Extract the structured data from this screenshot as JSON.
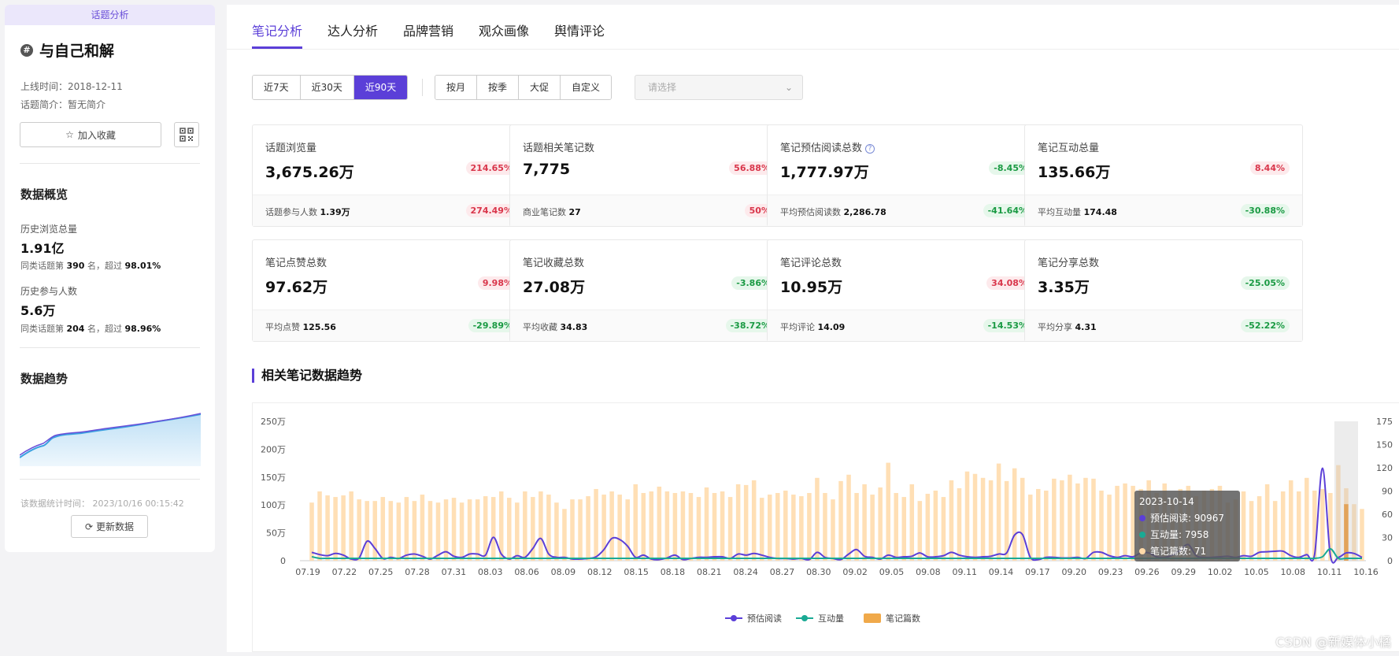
{
  "left": {
    "tag": "话题分析",
    "topic_title": "与自己和解",
    "online_time": "上线时间：2018-12-11",
    "intro": "话题简介：暂无简介",
    "fav_label": "加入收藏",
    "overview_title": "数据概览",
    "hist_views_label": "历史浏览总量",
    "hist_views_value": "1.91亿",
    "hist_views_rank_a": "同类话题第 ",
    "hist_views_rank_b": "390",
    "hist_views_rank_c": " 名，超过 ",
    "hist_views_rank_d": "98.01%",
    "hist_users_label": "历史参与人数",
    "hist_users_value": "5.6万",
    "hist_users_rank_a": "同类话题第 ",
    "hist_users_rank_b": "204",
    "hist_users_rank_c": " 名，超过 ",
    "hist_users_rank_d": "98.96%",
    "trend_title": "数据趋势",
    "stat_time": "该数据统计时间：  2023/10/16 00:15:42",
    "refresh_label": "更新数据"
  },
  "tabs": [
    "笔记分析",
    "达人分析",
    "品牌营销",
    "观众画像",
    "舆情评论"
  ],
  "ranges": [
    "近7天",
    "近30天",
    "近90天"
  ],
  "periods": [
    "按月",
    "按季",
    "大促",
    "自定义"
  ],
  "select_placeholder": "请选择",
  "cards": [
    {
      "label": "话题浏览量",
      "value": "3,675.26万",
      "pct": "214.65%",
      "dir": "up",
      "sublabel": "话题参与人数",
      "subvalue": "1.39万",
      "subpct": "274.49%",
      "subdir": "up"
    },
    {
      "label": "话题相关笔记数",
      "value": "7,775",
      "pct": "56.88%",
      "dir": "up",
      "sublabel": "商业笔记数",
      "subvalue": "27",
      "subpct": "50%",
      "subdir": "up"
    },
    {
      "label": "笔记预估阅读总数",
      "value": "1,777.97万",
      "pct": "-8.45%",
      "dir": "down",
      "sublabel": "平均预估阅读数",
      "subvalue": "2,286.78",
      "subpct": "-41.64%",
      "subdir": "down",
      "help": "?"
    },
    {
      "label": "笔记互动总量",
      "value": "135.66万",
      "pct": "8.44%",
      "dir": "up",
      "sublabel": "平均互动量",
      "subvalue": "174.48",
      "subpct": "-30.88%",
      "subdir": "down"
    },
    {
      "label": "笔记点赞总数",
      "value": "97.62万",
      "pct": "9.98%",
      "dir": "up",
      "sublabel": "平均点赞",
      "subvalue": "125.56",
      "subpct": "-29.89%",
      "subdir": "down"
    },
    {
      "label": "笔记收藏总数",
      "value": "27.08万",
      "pct": "-3.86%",
      "dir": "down",
      "sublabel": "平均收藏",
      "subvalue": "34.83",
      "subpct": "-38.72%",
      "subdir": "down"
    },
    {
      "label": "笔记评论总数",
      "value": "10.95万",
      "pct": "34.08%",
      "dir": "up",
      "sublabel": "平均评论",
      "subvalue": "14.09",
      "subpct": "-14.53%",
      "subdir": "down"
    },
    {
      "label": "笔记分享总数",
      "value": "3.35万",
      "pct": "-25.05%",
      "dir": "down",
      "sublabel": "平均分享",
      "subvalue": "4.31",
      "subpct": "-52.22%",
      "subdir": "down"
    }
  ],
  "trend_title": "相关笔记数据趋势",
  "watermark": "CSDN @新媒体小橘",
  "colors": {
    "accent": "#5b3fd8",
    "read": "#5b3fd8",
    "interact": "#1aaa94",
    "notes": "#ffd9a8",
    "up": "#d9364b",
    "down": "#1a9a43"
  },
  "chart_data": {
    "type": "bar+line",
    "x_ticks": [
      "07.19",
      "07.22",
      "07.25",
      "07.28",
      "07.31",
      "08.03",
      "08.06",
      "08.09",
      "08.12",
      "08.15",
      "08.18",
      "08.21",
      "08.24",
      "08.27",
      "08.30",
      "09.02",
      "09.05",
      "09.08",
      "09.11",
      "09.14",
      "09.17",
      "09.20",
      "09.23",
      "09.26",
      "09.29",
      "10.02",
      "10.05",
      "10.08",
      "10.11",
      "10.16"
    ],
    "y_left_ticks": [
      "250万",
      "200万",
      "150万",
      "100万",
      "50万",
      "0"
    ],
    "y_right_ticks": [
      "175",
      "150",
      "120",
      "90",
      "60",
      "30",
      "0"
    ],
    "ylim_left": [
      0,
      2500000
    ],
    "ylim_right": [
      0,
      175
    ],
    "legend": [
      "预估阅读",
      "互动量",
      "笔记篇数"
    ],
    "notes_count": [
      73,
      87,
      82,
      80,
      82,
      87,
      77,
      75,
      75,
      80,
      75,
      73,
      80,
      75,
      83,
      75,
      73,
      77,
      79,
      73,
      77,
      77,
      81,
      80,
      87,
      79,
      73,
      87,
      80,
      87,
      83,
      73,
      65,
      77,
      77,
      81,
      90,
      83,
      87,
      83,
      77,
      96,
      85,
      87,
      93,
      87,
      85,
      87,
      85,
      80,
      92,
      85,
      87,
      80,
      96,
      95,
      101,
      79,
      83,
      85,
      88,
      83,
      81,
      85,
      104,
      85,
      77,
      100,
      108,
      85,
      96,
      83,
      92,
      123,
      85,
      80,
      96,
      75,
      84,
      88,
      80,
      101,
      91,
      112,
      109,
      104,
      101,
      122,
      100,
      116,
      104,
      83,
      90,
      88,
      103,
      101,
      108,
      97,
      104,
      103,
      88,
      83,
      94,
      97,
      94,
      90,
      101,
      85,
      97,
      77,
      90,
      94,
      81,
      88,
      90,
      94,
      73,
      77,
      87,
      75,
      81,
      96,
      75,
      87,
      101,
      87,
      104,
      88,
      90,
      85,
      120,
      91,
      71,
      65
    ],
    "read_est": [
      150000,
      110000,
      90000,
      130000,
      100000,
      30000,
      50000,
      350000,
      220000,
      40000,
      60000,
      40000,
      100000,
      120000,
      80000,
      30000,
      100000,
      160000,
      80000,
      60000,
      120000,
      120000,
      100000,
      420000,
      120000,
      30000,
      90000,
      60000,
      220000,
      400000,
      120000,
      60000,
      60000,
      30000,
      30000,
      40000,
      70000,
      200000,
      400000,
      380000,
      260000,
      60000,
      100000,
      30000,
      20000,
      50000,
      100000,
      20000,
      40000,
      60000,
      60000,
      70000,
      70000,
      40000,
      120000,
      100000,
      130000,
      100000,
      60000,
      40000,
      40000,
      30000,
      40000,
      20000,
      150000,
      60000,
      40000,
      20000,
      120000,
      200000,
      80000,
      60000,
      30000,
      100000,
      60000,
      70000,
      80000,
      140000,
      70000,
      70000,
      90000,
      150000,
      100000,
      70000,
      60000,
      70000,
      80000,
      120000,
      140000,
      460000,
      470000,
      60000,
      20000,
      60000,
      60000,
      50000,
      50000,
      60000,
      40000,
      150000,
      150000,
      90000,
      60000,
      90000,
      70000,
      140000,
      140000,
      70000,
      60000,
      100000,
      190000,
      290000,
      90000,
      60000,
      60000,
      70000,
      80000,
      60000,
      90000,
      80000,
      150000,
      160000,
      170000,
      170000,
      90000,
      60000,
      110000,
      110000,
      1660000,
      90000,
      60000,
      140000,
      130000,
      60000
    ],
    "interact": [
      5,
      3,
      3,
      3,
      3,
      3,
      3,
      3,
      3,
      3,
      3,
      3,
      3,
      3,
      3,
      3,
      3,
      3,
      3,
      3,
      3,
      3,
      3,
      3,
      3,
      3,
      3,
      3,
      3,
      3,
      3,
      3,
      3,
      3,
      3,
      3,
      3,
      3,
      3,
      3,
      3,
      3,
      3,
      3,
      3,
      3,
      3,
      3,
      3,
      3,
      3,
      3,
      3,
      3,
      3,
      3,
      3,
      3,
      3,
      3,
      3,
      3,
      3,
      3,
      3,
      3,
      3,
      3,
      3,
      3,
      3,
      3,
      3,
      3,
      3,
      3,
      3,
      3,
      3,
      3,
      3,
      3,
      3,
      3,
      3,
      3,
      3,
      3,
      3,
      3,
      3,
      3,
      3,
      3,
      3,
      3,
      3,
      3,
      3,
      3,
      3,
      3,
      3,
      3,
      3,
      3,
      3,
      3,
      3,
      3,
      3,
      3,
      3,
      3,
      3,
      3,
      3,
      3,
      3,
      3,
      3,
      3,
      3,
      3,
      3,
      3,
      3,
      3,
      5,
      15,
      3,
      3,
      3,
      3
    ],
    "tooltip": {
      "date": "2023-10-14",
      "read_label": "预估阅读: 90967",
      "interact_label": "互动量: 7958",
      "notes_label": "笔记篇数: 71"
    }
  }
}
